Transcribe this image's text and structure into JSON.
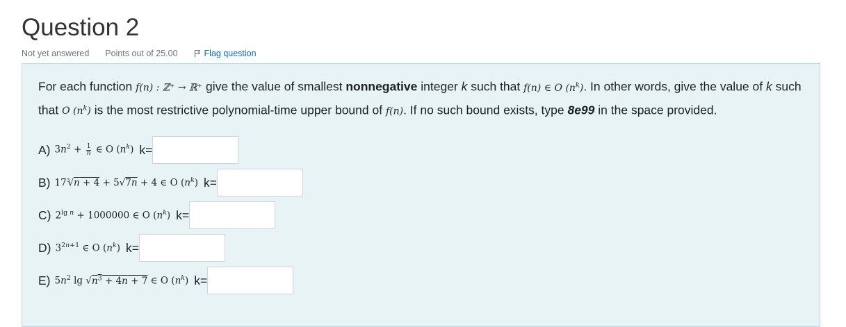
{
  "question": {
    "title": "Question 2",
    "state": "Not yet answered",
    "grade": "Points out of 25.00",
    "flag_label": "Flag question"
  },
  "prompt": {
    "p1": "For each function ",
    "f_map": "f(n) : ℤ⁺ → ℝ⁺",
    "p2": " give the value of smallest ",
    "bold": "nonnegative",
    "p3": " integer ",
    "k1": "k",
    "p4": " such that ",
    "cond": "f(n) ∈ O (n",
    "p5": ". In other words, give the value of ",
    "k2": "k",
    "p6": " such that ",
    "o_nk": "O (n",
    "p7": " is the most restrictive polynomial-time upper bound of ",
    "f_n": "f(n)",
    "p8": ". If no such bound exists, type ",
    "special": "8e99",
    "p9": " in the space provided."
  },
  "parts": [
    {
      "label": "A)",
      "expr_text": "3n² + 1/n ∈ O (nᵏ)",
      "k_label": "k=",
      "value": ""
    },
    {
      "label": "B)",
      "expr_text": "17∛(n+4) + 5√(7n) + 4 ∈ O (nᵏ)",
      "k_label": "k=",
      "value": ""
    },
    {
      "label": "C)",
      "expr_text": "2^(lg n) + 1000000 ∈ O (nᵏ)",
      "k_label": "k=",
      "value": ""
    },
    {
      "label": "D)",
      "expr_text": "3^(2n+1) ∈ O (nᵏ)",
      "k_label": "k=",
      "value": ""
    },
    {
      "label": "E)",
      "expr_text": "5n² lg √(n³ + 4n + 7) ∈ O (nᵏ)",
      "k_label": "k=",
      "value": ""
    }
  ],
  "colors": {
    "formulation_bg": "#e7f3f5",
    "formulation_border": "#b8dce2",
    "link": "#0f6cbf"
  },
  "icons": [
    "flag-icon"
  ]
}
